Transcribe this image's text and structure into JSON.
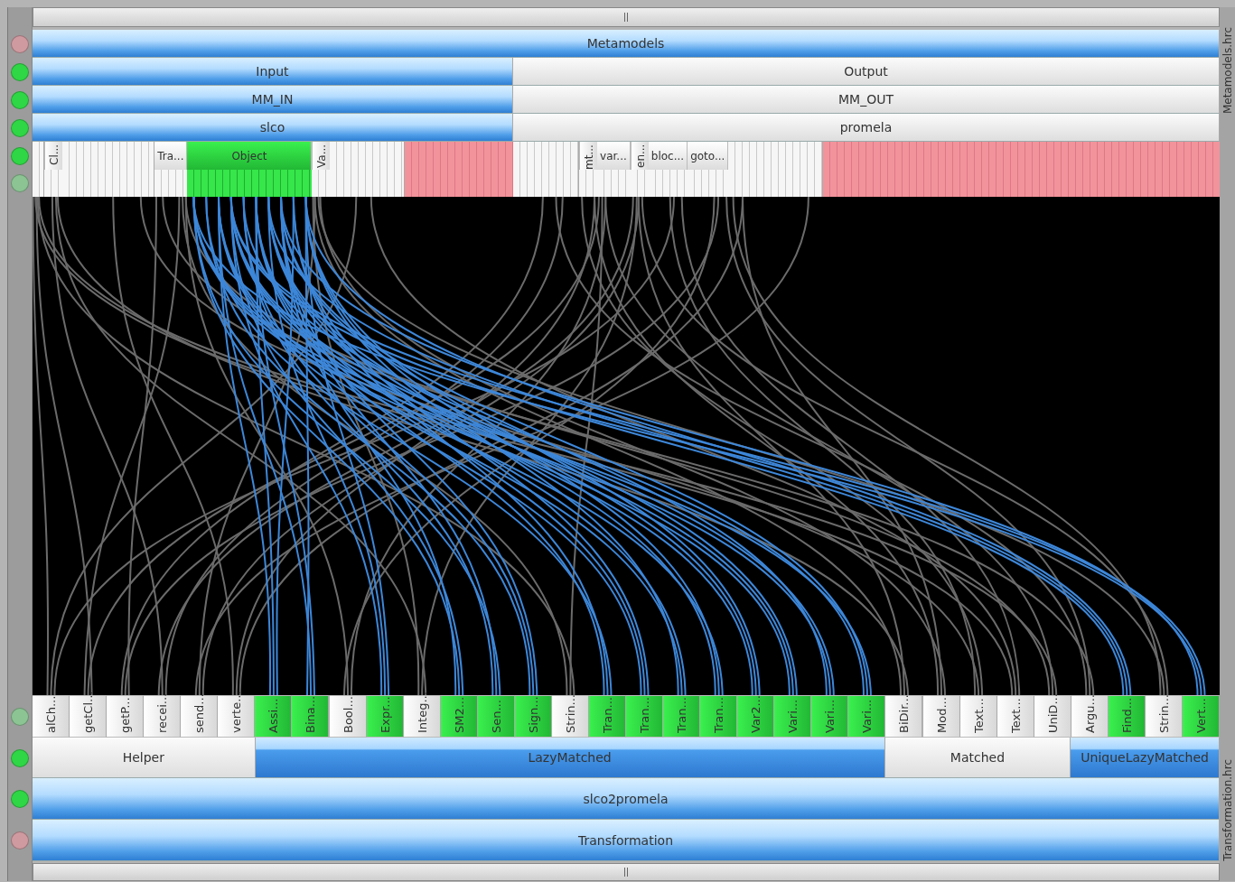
{
  "metamodels_header": {
    "label": "Metamodels",
    "selected": true,
    "valid": false,
    "dimmed": true
  },
  "model_rows": [
    {
      "valid": true,
      "dimmed": false,
      "left": {
        "label": "Input",
        "selected": true
      },
      "right": {
        "label": "Output",
        "selected": false
      }
    },
    {
      "valid": true,
      "dimmed": false,
      "left": {
        "label": "MM_IN",
        "selected": true
      },
      "right": {
        "label": "MM_OUT",
        "selected": false
      }
    },
    {
      "valid": true,
      "dimmed": false,
      "left": {
        "label": "slco",
        "selected": true
      },
      "right": {
        "label": "promela",
        "selected": false
      }
    }
  ],
  "type_rows": {
    "valid": true,
    "dimmed": false,
    "sub_valid": true,
    "sub_dimmed": true,
    "sides": [
      {
        "segments": [
          {
            "kind": "filler"
          },
          {
            "kind": "type",
            "label": "Cl...",
            "vertical": true,
            "selected": false
          },
          {
            "kind": "filler"
          },
          {
            "kind": "type",
            "label": "Tra...",
            "vertical": false,
            "selected": false
          },
          {
            "kind": "type",
            "label": "Object",
            "vertical": false,
            "selected": true
          },
          {
            "kind": "type",
            "label": "Va...",
            "vertical": true,
            "selected": false
          },
          {
            "kind": "filler"
          },
          {
            "kind": "unmatched"
          }
        ]
      },
      {
        "segments": [
          {
            "kind": "filler"
          },
          {
            "kind": "type",
            "label": "mt...",
            "vertical": true,
            "selected": false
          },
          {
            "kind": "type",
            "label": "var...",
            "vertical": false,
            "selected": false
          },
          {
            "kind": "type",
            "label": "en...",
            "vertical": true,
            "selected": false
          },
          {
            "kind": "type",
            "label": "bloc...",
            "vertical": false,
            "selected": false
          },
          {
            "kind": "type",
            "label": "goto...",
            "vertical": false,
            "selected": false
          },
          {
            "kind": "filler"
          },
          {
            "kind": "unmatched"
          }
        ]
      }
    ]
  },
  "elements_row": {
    "valid": true,
    "dimmed": true
  },
  "rule_kinds": {
    "valid": true,
    "dimmed": false,
    "items": [
      {
        "label": "Helper",
        "selected": false,
        "elements": [
          {
            "label": "alCh...",
            "selected": false
          },
          {
            "label": "getCl...",
            "selected": false
          },
          {
            "label": "getP...",
            "selected": false
          },
          {
            "label": "recei...",
            "selected": false
          },
          {
            "label": "send...",
            "selected": false
          },
          {
            "label": "verte...",
            "selected": false
          }
        ]
      },
      {
        "label": "LazyMatched",
        "selected": true,
        "elements": [
          {
            "label": "Assi...",
            "selected": true
          },
          {
            "label": "Bina...",
            "selected": true
          },
          {
            "label": "Bool...",
            "selected": false
          },
          {
            "label": "Expr...",
            "selected": true
          },
          {
            "label": "Integ...",
            "selected": false
          },
          {
            "label": "SM2...",
            "selected": true
          },
          {
            "label": "Sen...",
            "selected": true
          },
          {
            "label": "Sign...",
            "selected": true
          },
          {
            "label": "Strin...",
            "selected": false
          },
          {
            "label": "Tran...",
            "selected": true
          },
          {
            "label": "Tran...",
            "selected": true
          },
          {
            "label": "Tran...",
            "selected": true
          },
          {
            "label": "Tran...",
            "selected": true
          },
          {
            "label": "Var2...",
            "selected": true
          },
          {
            "label": "Vari...",
            "selected": true
          },
          {
            "label": "Vari...",
            "selected": true
          },
          {
            "label": "Vari...",
            "selected": true
          }
        ]
      },
      {
        "label": "Matched",
        "selected": false,
        "elements": [
          {
            "label": "BiDir...",
            "selected": false
          },
          {
            "label": "Mod...",
            "selected": false
          },
          {
            "label": "Text...",
            "selected": false
          },
          {
            "label": "Text...",
            "selected": false
          },
          {
            "label": "UniD...",
            "selected": false
          }
        ]
      },
      {
        "label": "UniqueLazyMatched",
        "selected": true,
        "elements": [
          {
            "label": "Argu...",
            "selected": false
          },
          {
            "label": "Find...",
            "selected": true
          },
          {
            "label": "Strin...",
            "selected": false
          },
          {
            "label": "Vert...",
            "selected": true
          }
        ]
      }
    ]
  },
  "transformation_rows": [
    {
      "label": "slco2promela",
      "selected": true,
      "valid": true,
      "dimmed": false
    },
    {
      "label": "Transformation",
      "selected": true,
      "valid": false,
      "dimmed": true
    }
  ],
  "side_labels": [
    "Metamodels.hrc",
    "Transformation.hrc"
  ]
}
